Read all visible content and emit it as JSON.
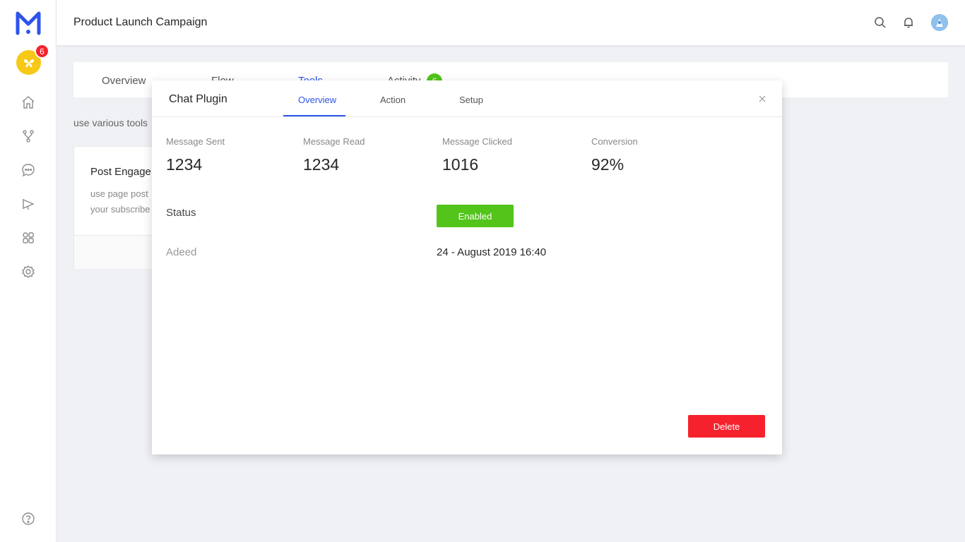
{
  "header": {
    "title": "Product Launch Campaign"
  },
  "sidebar": {
    "brand_badge_count": "6",
    "items": [
      {
        "icon": "home-icon"
      },
      {
        "icon": "flow-branch-icon"
      },
      {
        "icon": "chat-icon"
      },
      {
        "icon": "megaphone-icon"
      },
      {
        "icon": "apps-icon"
      },
      {
        "icon": "settings-icon"
      }
    ]
  },
  "background": {
    "tabs": [
      {
        "label": "Overview"
      },
      {
        "label": "Flow"
      },
      {
        "label": "Tools"
      },
      {
        "label": "Activity"
      }
    ],
    "activity_count": "6",
    "description": "use various tools",
    "card": {
      "title": "Post Engage",
      "line1": "use page post",
      "line2": "your subscribe"
    }
  },
  "modal": {
    "title": "Chat Plugin",
    "tabs": [
      {
        "label": "Overview"
      },
      {
        "label": "Action"
      },
      {
        "label": "Setup"
      }
    ],
    "stats": [
      {
        "label": "Message Sent",
        "value": "1234"
      },
      {
        "label": "Message Read",
        "value": "1234"
      },
      {
        "label": "Message Clicked",
        "value": "1016"
      },
      {
        "label": "Conversion",
        "value": "92%"
      }
    ],
    "status_label": "Status",
    "status_value": "Enabled",
    "added_label": "Adeed",
    "added_value": "24 - August 2019 16:40",
    "delete_label": "Delete"
  },
  "colors": {
    "accent": "#2f54eb",
    "success": "#52c41a",
    "danger": "#f5222d",
    "brand_badge": "#f7c815"
  }
}
